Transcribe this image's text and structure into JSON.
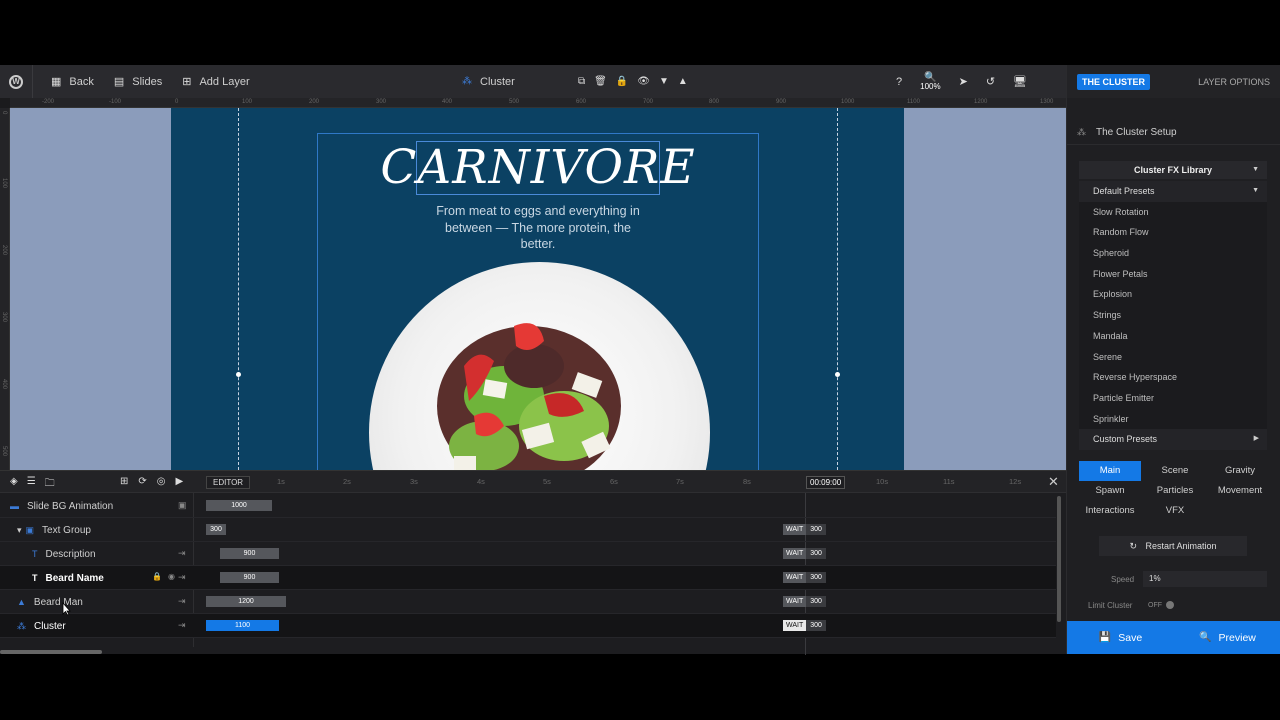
{
  "toolbar": {
    "back": "Back",
    "slides": "Slides",
    "add_layer": "Add Layer",
    "current_layer": "Cluster",
    "zoom": "100%"
  },
  "ruler": {
    "top_ticks": [
      "-200",
      "-100",
      "0",
      "100",
      "200",
      "300",
      "400",
      "500",
      "600",
      "700",
      "800",
      "900",
      "1000",
      "1100",
      "1200",
      "1300"
    ],
    "left_ticks": [
      "0",
      "100",
      "200",
      "300",
      "400",
      "500"
    ]
  },
  "slide": {
    "title": "CARNIVORE",
    "description": "From meat to eggs and everything in between — The more protein, the better."
  },
  "timeline": {
    "editor_label": "EDITOR",
    "time_ticks": [
      "1s",
      "2s",
      "3s",
      "4s",
      "5s",
      "6s",
      "7s",
      "8s",
      "10s",
      "11s",
      "12s"
    ],
    "playhead": "00:09:00",
    "rows": [
      {
        "label": "Slide BG Animation",
        "bar": "1000"
      },
      {
        "label": "Text Group",
        "bar": "300",
        "wait": "WAIT",
        "wait_val": "300"
      },
      {
        "label": "Description",
        "bar": "900",
        "wait": "WAIT",
        "wait_val": "300"
      },
      {
        "label": "Beard Name",
        "bar": "900",
        "wait": "WAIT",
        "wait_val": "300"
      },
      {
        "label": "Beard Man",
        "bar": "1200",
        "wait": "WAIT",
        "wait_val": "300"
      },
      {
        "label": "Cluster",
        "bar": "1100",
        "wait": "WAIT",
        "wait_val": "300"
      }
    ]
  },
  "panel": {
    "badge": "THE CLUSTER",
    "layer_options": "LAYER OPTIONS",
    "setup_title": "The Cluster Setup",
    "library": "Cluster FX Library",
    "presets_head": "Default Presets",
    "presets": [
      "Slow Rotation",
      "Random Flow",
      "Spheroid",
      "Flower Petals",
      "Explosion",
      "Strings",
      "Mandala",
      "Serene",
      "Reverse Hyperspace",
      "Particle Emitter",
      "Sprinkler"
    ],
    "custom_presets": "Custom Presets",
    "tabs": [
      "Main",
      "Scene",
      "Gravity",
      "Spawn",
      "Particles",
      "Movement",
      "Interactions",
      "VFX"
    ],
    "restart": "Restart Animation",
    "speed_label": "Speed",
    "speed_value": "1%",
    "limit_label": "Limit Cluster",
    "limit_value": "OFF",
    "save": "Save",
    "preview": "Preview"
  },
  "colors": {
    "accent": "#1479e6",
    "slide_bg": "#0b4163",
    "canvas_bg": "#8b9cbb"
  }
}
